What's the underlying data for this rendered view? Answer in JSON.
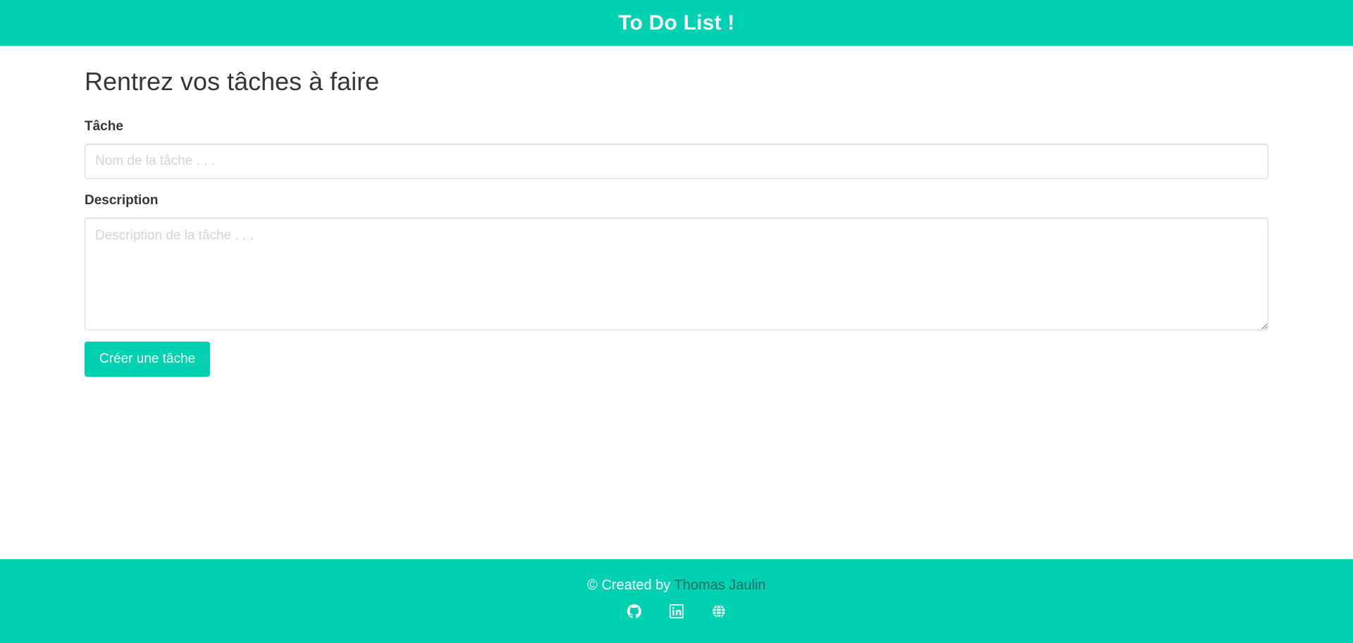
{
  "header": {
    "title": "To Do List !"
  },
  "main": {
    "heading": "Rentrez vos tâches à faire",
    "task": {
      "label": "Tâche",
      "placeholder": "Nom de la tâche . . .",
      "value": ""
    },
    "description": {
      "label": "Description",
      "placeholder": "Description de la tâche . . .",
      "value": ""
    },
    "create_button_label": "Créer une tâche"
  },
  "footer": {
    "credit_prefix": "© Created by ",
    "author": "Thomas Jaulin",
    "links": [
      {
        "icon": "github-icon"
      },
      {
        "icon": "linkedin-icon"
      },
      {
        "icon": "globe-icon"
      }
    ]
  },
  "colors": {
    "accent": "#00d1b2",
    "text": "#363636",
    "author_link": "#1f6f64"
  }
}
